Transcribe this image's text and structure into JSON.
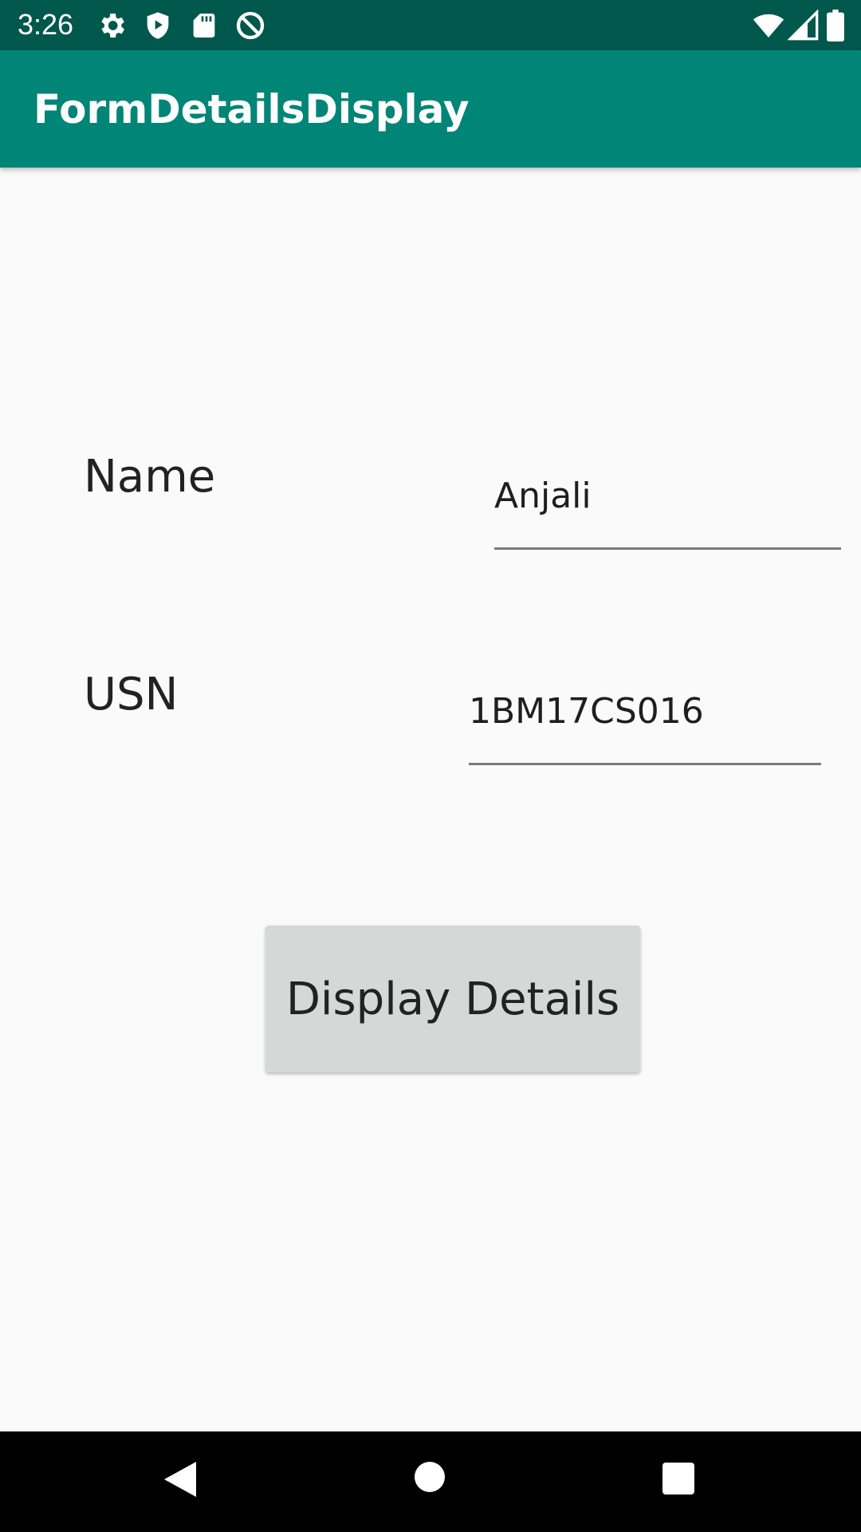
{
  "status_bar": {
    "time": "3:26",
    "left_icons": [
      "gear-icon",
      "shield-play-icon",
      "sd-card-icon",
      "do-not-disturb-icon"
    ],
    "right_icons": [
      "wifi-icon",
      "cellular-signal-icon",
      "battery-icon"
    ],
    "color": "#00574b"
  },
  "app_bar": {
    "title": "FormDetailsDisplay",
    "color": "#008577"
  },
  "form": {
    "name_label": "Name",
    "name_value": "Anjali",
    "usn_label": "USN",
    "usn_value": "1BM17CS016",
    "submit_label": "Display Details"
  },
  "nav_bar": {
    "buttons": [
      "back-icon",
      "home-icon",
      "recents-icon"
    ]
  }
}
